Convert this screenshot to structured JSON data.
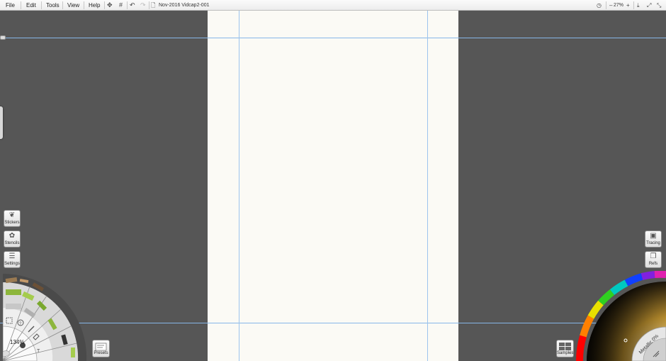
{
  "menubar": {
    "menus": [
      "File",
      "Edit",
      "Tools",
      "View",
      "Help"
    ],
    "document_title": "Nov-2016 Vidcap2-001",
    "zoom_level": "27%"
  },
  "left_tools": {
    "stickers_label": "Stickers",
    "stencils_label": "Stencils",
    "settings_label": "Settings"
  },
  "tool_palette": {
    "brush_size": "134%"
  },
  "presets_label": "Presets",
  "right_tools": {
    "tracing_label": "Tracing",
    "refs_label": "Refs",
    "samples_label": "Samples"
  },
  "color_picker": {
    "metallic_label": "Metallic 0%"
  },
  "colors": {
    "background": "#565656",
    "canvas": "#fbfaf5",
    "guide": "#86b6e8"
  }
}
